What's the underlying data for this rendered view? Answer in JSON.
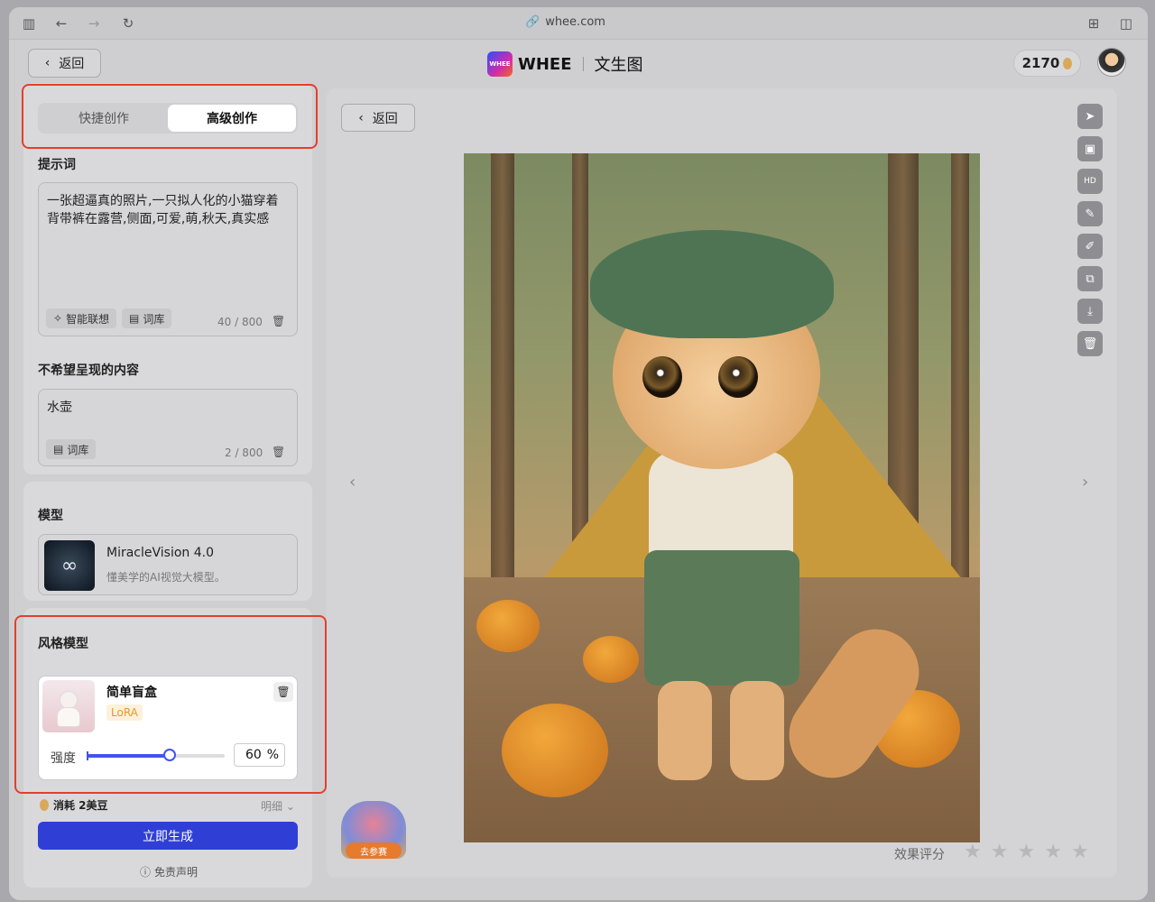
{
  "browser": {
    "url": "whee.com",
    "icons": [
      "sidebar-icon",
      "back-arrow-icon",
      "forward-arrow-icon",
      "reload-icon",
      "link-icon",
      "extension-icon",
      "split-view-icon"
    ]
  },
  "header": {
    "back_label": "返回",
    "brand": "WHEE",
    "brand_badge": "WHEE",
    "page_title": "文生图",
    "beans": "2170"
  },
  "tabs": [
    {
      "label": "快捷创作",
      "selected": false
    },
    {
      "label": "高级创作",
      "selected": true
    }
  ],
  "prompt": {
    "label": "提示词",
    "text": "一张超逼真的照片,一只拟人化的小猫穿着背带裤在露营,侧面,可爱,萌,秋天,真实感",
    "smart_label": "智能联想",
    "lexicon_label": "词库",
    "count": "40 / 800"
  },
  "negative": {
    "label": "不希望呈现的内容",
    "text": "水壶",
    "lexicon_label": "词库",
    "count": "2 / 800"
  },
  "model": {
    "label": "模型",
    "name": "MiracleVision 4.0",
    "desc": "懂美学的AI视觉大模型。"
  },
  "style_model": {
    "label": "风格模型",
    "name": "简单盲盒",
    "tag": "LoRA",
    "strength_label": "强度",
    "strength_value": "60",
    "strength_unit": "%",
    "strength_fraction": 0.6
  },
  "footer": {
    "cost": "消耗 2美豆",
    "detail": "明细",
    "generate": "立即生成",
    "disclaimer": "免责声明"
  },
  "main": {
    "back_label": "返回",
    "rating_label": "效果评分",
    "rating_stars": 5,
    "rating_value": 0,
    "activity_badge": "去参赛",
    "tools": [
      "send-icon",
      "image-to-image-icon",
      "hd-icon",
      "brush-icon",
      "edit-icon",
      "expand-icon",
      "download-icon",
      "delete-icon"
    ]
  },
  "colors": {
    "accent": "#2f3fd6",
    "highlight": "#e2402a",
    "lora_tag": "#e19a2b"
  }
}
